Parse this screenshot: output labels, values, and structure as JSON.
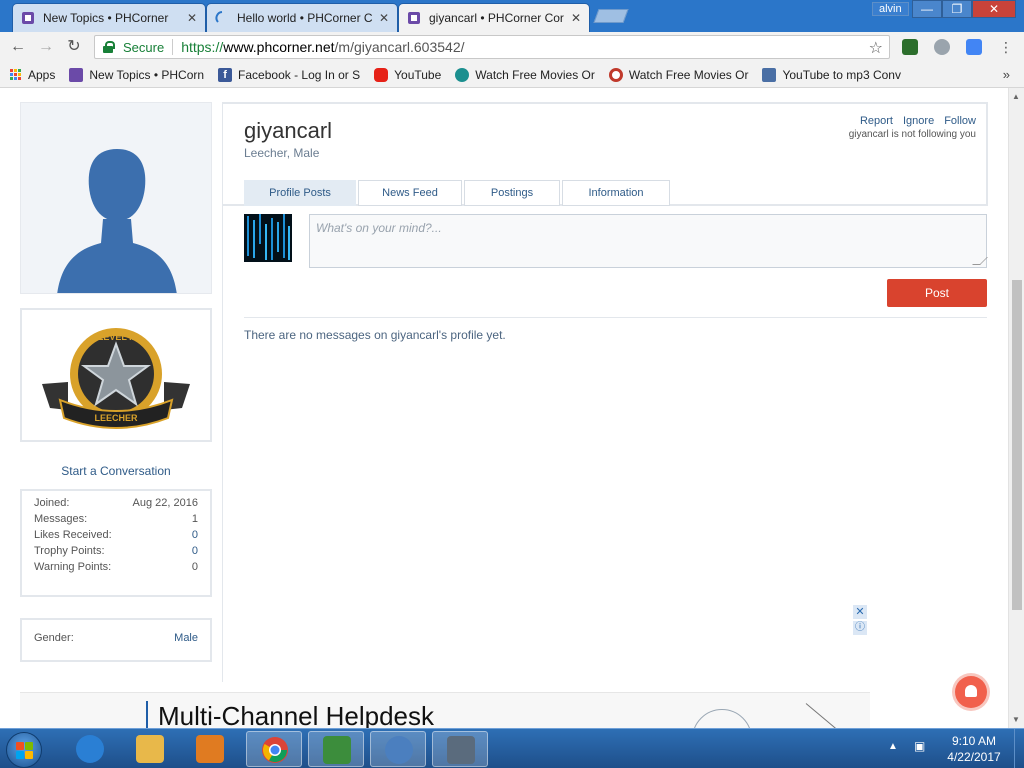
{
  "browser": {
    "tabs": [
      {
        "label": "New Topics • PHCorner",
        "close": "✕"
      },
      {
        "label": "Hello world • PHCorner C",
        "close": "✕"
      },
      {
        "label": "giyancarl • PHCorner Cor",
        "close": "✕"
      }
    ],
    "user_badge": "alvin",
    "window_buttons": {
      "minimize": "—",
      "maximize": "❐",
      "close": "✕"
    },
    "secure_label": "Secure",
    "url": {
      "proto": "https://",
      "host": "www.phcorner.net",
      "path": "/m/giyancarl.603542/"
    },
    "bookmarks": [
      {
        "label": "Apps",
        "icon": "apps-grid-icon"
      },
      {
        "label": "New Topics • PHCorn",
        "icon": "phcorner-icon",
        "color": "#6b4aa8"
      },
      {
        "label": "Facebook - Log In or S",
        "icon": "facebook-icon",
        "color": "#3b5998"
      },
      {
        "label": "YouTube",
        "icon": "youtube-icon",
        "color": "#e62117"
      },
      {
        "label": "Watch Free Movies Or",
        "icon": "play-circle-icon",
        "color": "#1b8f8f"
      },
      {
        "label": "Watch Free Movies Or",
        "icon": "target-icon",
        "color": "#c0392b"
      },
      {
        "label": "YouTube to mp3 Conv",
        "icon": "yt-mp3-icon",
        "color": "#4a6fa5"
      }
    ],
    "bookmarks_more": "»"
  },
  "profile": {
    "username": "giyancarl",
    "user_title": "Leecher, Male",
    "actions": [
      "Report",
      "Ignore",
      "Follow"
    ],
    "follow_note": "giyancarl is not following you",
    "tabs": [
      "Profile Posts",
      "News Feed",
      "Postings",
      "Information"
    ],
    "active_tab": "Profile Posts",
    "post_placeholder": "What's on your mind?...",
    "post_button": "Post",
    "no_messages": "There are no messages on giyancarl's profile yet."
  },
  "sidebar": {
    "badge": {
      "level_text": "LEVEL II",
      "rank_text": "LEECHER"
    },
    "start_conversation": "Start a Conversation",
    "stats": [
      {
        "label": "Joined:",
        "value": "Aug 22, 2016",
        "link": false
      },
      {
        "label": "Messages:",
        "value": "1",
        "link": false
      },
      {
        "label": "Likes Received:",
        "value": "0",
        "link": true
      },
      {
        "label": "Trophy Points:",
        "value": "0",
        "link": true
      },
      {
        "label": "Warning Points:",
        "value": "0",
        "link": false
      }
    ],
    "gender": {
      "label": "Gender:",
      "value": "Male"
    }
  },
  "ad": {
    "headline": "Multi-Channel Helpdesk",
    "close": "✕",
    "info": "ⓘ"
  },
  "taskbar": {
    "items": [
      {
        "name": "internet-explorer-icon",
        "color": "#2a7fd4"
      },
      {
        "name": "file-explorer-icon",
        "color": "#e8b84a"
      },
      {
        "name": "media-player-icon",
        "color": "#e07b21"
      },
      {
        "name": "chrome-icon",
        "color": "#34a853",
        "running": true
      },
      {
        "name": "download-manager-icon",
        "color": "#3c8d3c"
      },
      {
        "name": "eagle-app-icon",
        "color": "#4b7fbf"
      },
      {
        "name": "settings-gear-icon",
        "color": "#5a6b7d"
      }
    ],
    "tray_arrow": "▲",
    "time": "9:10 AM",
    "date": "4/22/2017"
  },
  "colors": {
    "titlebar": "#2b76c9",
    "post_button": "#d9432e",
    "link": "#2f5b88",
    "secure": "#188038"
  }
}
